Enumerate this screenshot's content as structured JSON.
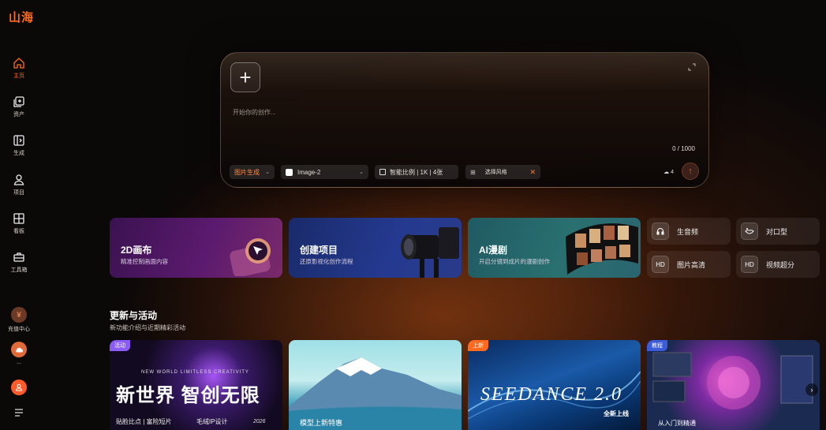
{
  "app": {
    "logo_text": "山海"
  },
  "sidebar": {
    "items": [
      {
        "label": "主页",
        "icon": "home-icon"
      },
      {
        "label": "资产",
        "icon": "assets-icon"
      },
      {
        "label": "生成",
        "icon": "generate-icon"
      },
      {
        "label": "项目",
        "icon": "project-icon"
      },
      {
        "label": "看板",
        "icon": "board-icon"
      },
      {
        "label": "工具箱",
        "icon": "toolbox-icon"
      }
    ],
    "recharge_label": "充值中心",
    "recharge_icon": "¥",
    "more_label": "...",
    "avatar_icon": "user-icon",
    "menu_icon": "menu-icon"
  },
  "prompt": {
    "placeholder": "开始你的创作...",
    "counter": "0 / 1000",
    "mode_label": "图片生成",
    "model_label": "Image-2",
    "ratio_label": "智能比例 | 1K | 4张",
    "style_label": "选择风格",
    "credit_count": "4",
    "accent_color": "#ff6a1f"
  },
  "features": [
    {
      "title": "2D画布",
      "subtitle": "精准控制画面内容"
    },
    {
      "title": "创建项目",
      "subtitle": "还原影视化创作流程"
    },
    {
      "title": "AI漫剧",
      "subtitle": "开启分镜到成片的漫剧创作"
    }
  ],
  "tools": [
    {
      "label": "生音频",
      "icon": "headphone-icon"
    },
    {
      "label": "对口型",
      "icon": "lip-sync-icon"
    },
    {
      "label": "图片高清",
      "icon": "hd-icon"
    },
    {
      "label": "视频超分",
      "icon": "hd-video-icon"
    }
  ],
  "updates": {
    "title": "更新与活动",
    "subtitle": "新功能介绍与近期精彩活动",
    "banners": [
      {
        "tag": "活动",
        "tag_color": "#8b5cf6",
        "headline": "新世界 智创无限",
        "kicker": "NEW WORLD  LIMITLESS CREATIVITY",
        "line1": "贴脸比点 | 富险短片",
        "line2": "毛绒IP设计",
        "year": "2026"
      },
      {
        "tag": "",
        "tag_color": "",
        "headline": "模型上新特惠",
        "kicker": "",
        "line1": "",
        "line2": "",
        "year": ""
      },
      {
        "tag": "上新",
        "tag_color": "#ff6a1f",
        "headline": "SEEDANCE 2.0",
        "kicker": "",
        "line1": "全新上线",
        "line2": "",
        "year": ""
      },
      {
        "tag": "教程",
        "tag_color": "#3b5bdb",
        "headline": "从入门到精通",
        "kicker": "",
        "line1": "",
        "line2": "",
        "year": ""
      }
    ]
  }
}
